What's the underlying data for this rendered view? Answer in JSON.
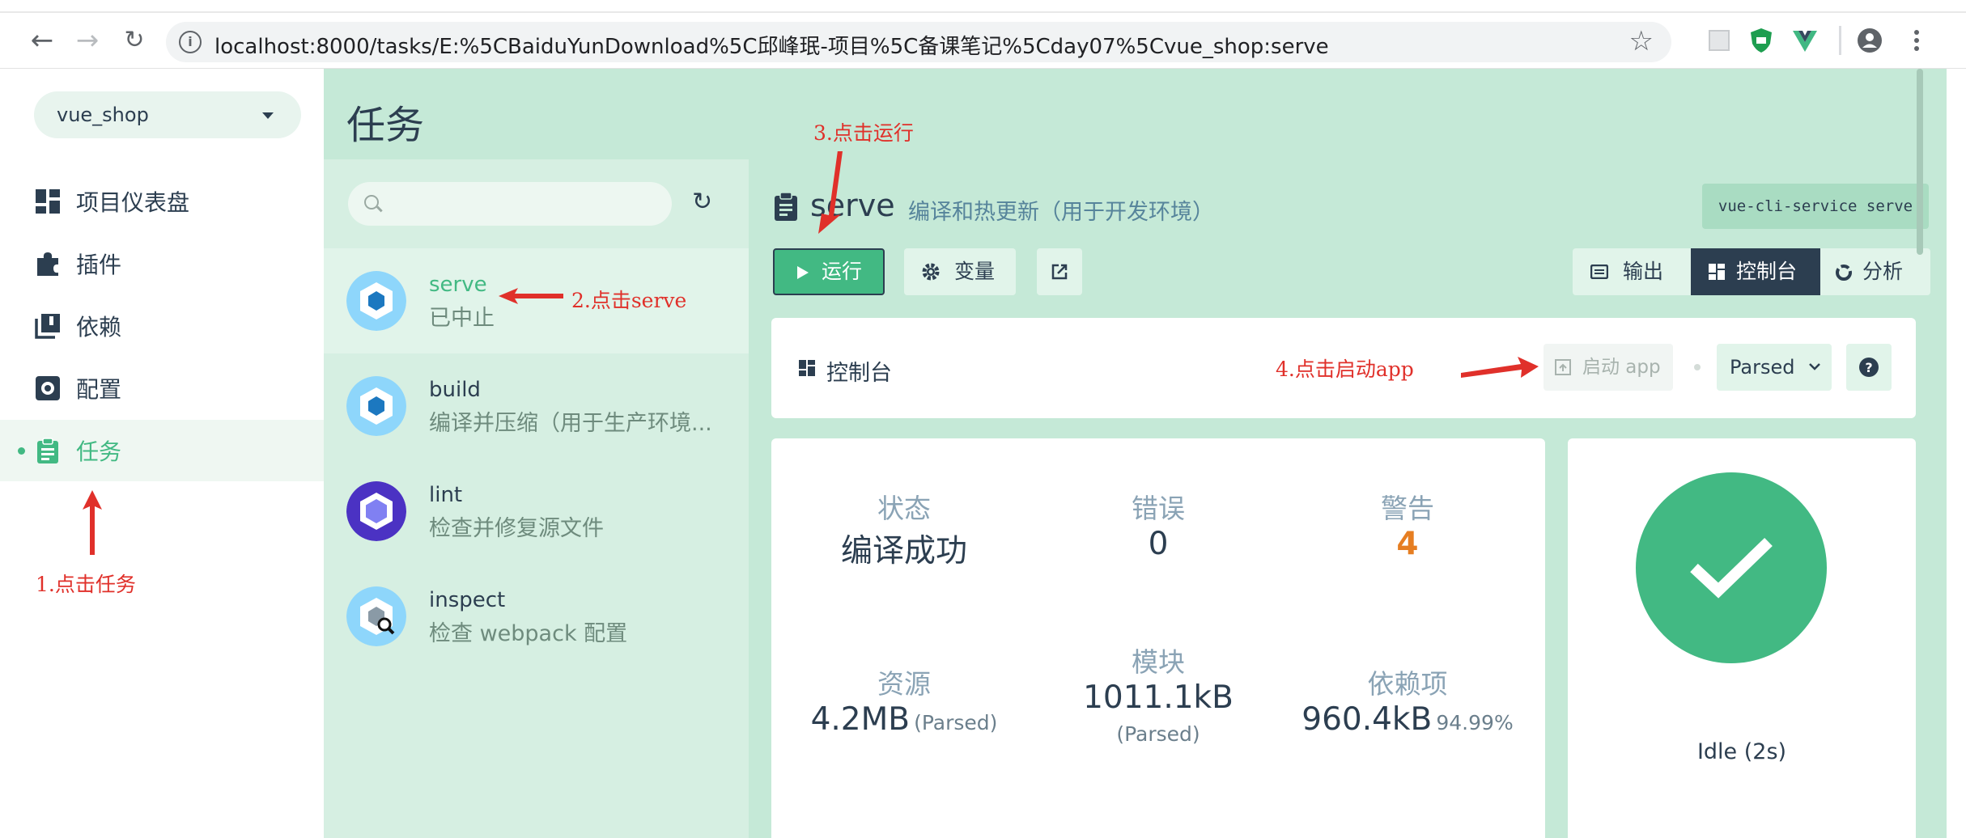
{
  "browser": {
    "url": "localhost:8000/tasks/E:%5CBaiduYunDownload%5C邱峰珉-项目%5C备课笔记%5Cday07%5Cvue_shop:serve"
  },
  "sidebar": {
    "project": "vue_shop",
    "items": [
      {
        "label": "项目仪表盘",
        "icon": "dashboard-icon"
      },
      {
        "label": "插件",
        "icon": "puzzle-icon"
      },
      {
        "label": "依赖",
        "icon": "library-icon"
      },
      {
        "label": "配置",
        "icon": "settings-icon"
      },
      {
        "label": "任务",
        "icon": "clipboard-icon",
        "active": true
      }
    ]
  },
  "page": {
    "title": "任务"
  },
  "tasks": [
    {
      "name": "serve",
      "desc": "已中止",
      "selected": true
    },
    {
      "name": "build",
      "desc": "编译并压缩（用于生产环境..."
    },
    {
      "name": "lint",
      "desc": "检查并修复源文件"
    },
    {
      "name": "inspect",
      "desc": "检查 webpack 配置"
    }
  ],
  "detail": {
    "title": "serve",
    "desc": "编译和热更新（用于开发环境）",
    "command": "vue-cli-service serve",
    "run_label": "运行",
    "vars_label": "变量",
    "views": {
      "output": "输出",
      "dashboard": "控制台",
      "analyze": "分析"
    },
    "dashboard_label": "控制台",
    "start_app_label": "启动 app",
    "parsed_label": "Parsed"
  },
  "stats": {
    "status": {
      "label": "状态",
      "value": "编译成功"
    },
    "errors": {
      "label": "错误",
      "value": "0"
    },
    "warnings": {
      "label": "警告",
      "value": "4"
    },
    "assets": {
      "label": "资源",
      "value": "4.2MB",
      "sub": "(Parsed)"
    },
    "modules": {
      "label": "模块",
      "value": "1011.1kB",
      "sub": "(Parsed)"
    },
    "deps": {
      "label": "依赖项",
      "value": "960.4kB",
      "sub": "94.99%"
    }
  },
  "status_card": {
    "idle": "Idle (2s)"
  },
  "annotations": {
    "a1": "1.点击任务",
    "a2": "2.点击serve",
    "a3": "3.点击运行",
    "a4": "4.点击启动app"
  },
  "colors": {
    "accent": "#42b983",
    "main_bg": "#c5e9d7",
    "dark": "#2c3e50",
    "warning": "#e67e22",
    "annotation": "#e0302a"
  }
}
